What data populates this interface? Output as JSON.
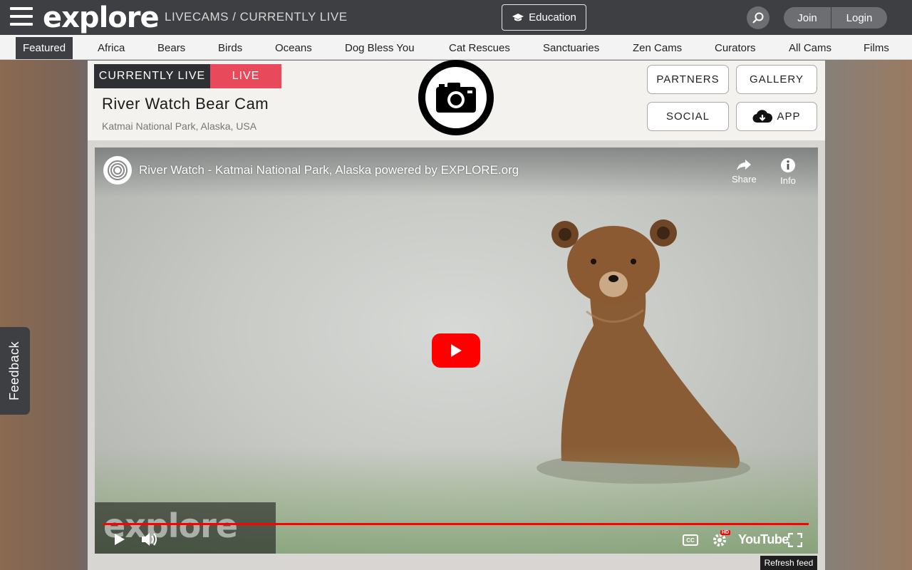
{
  "header": {
    "logo": "explore",
    "breadcrumb": "LIVECAMS / CURRENTLY LIVE",
    "education_label": "Education",
    "join_label": "Join",
    "login_label": "Login"
  },
  "nav": {
    "items": [
      "Featured",
      "Africa",
      "Bears",
      "Birds",
      "Oceans",
      "Dog Bless You",
      "Cat Rescues",
      "Sanctuaries",
      "Zen Cams",
      "Curators",
      "All Cams",
      "Films"
    ],
    "active": "Featured"
  },
  "cam": {
    "currently_live": "CURRENTLY LIVE",
    "live": "LIVE",
    "title": "River Watch Bear Cam",
    "location": "Katmai National Park, Alaska, USA"
  },
  "buttons": {
    "partners": "PARTNERS",
    "gallery": "GALLERY",
    "social": "SOCIAL",
    "app": "APP"
  },
  "video": {
    "title": "River Watch - Katmai National Park, Alaska powered by EXPLORE.org",
    "share": "Share",
    "info": "Info",
    "watermark": "explore",
    "brand": "YouTube",
    "cc": "CC",
    "hd": "HD",
    "progress": 1.0
  },
  "refresh_label": "Refresh feed",
  "feedback_label": "Feedback",
  "colors": {
    "topbar": "#3d3f42",
    "live_red": "#e84a5b",
    "youtube_red": "#ff0000"
  }
}
